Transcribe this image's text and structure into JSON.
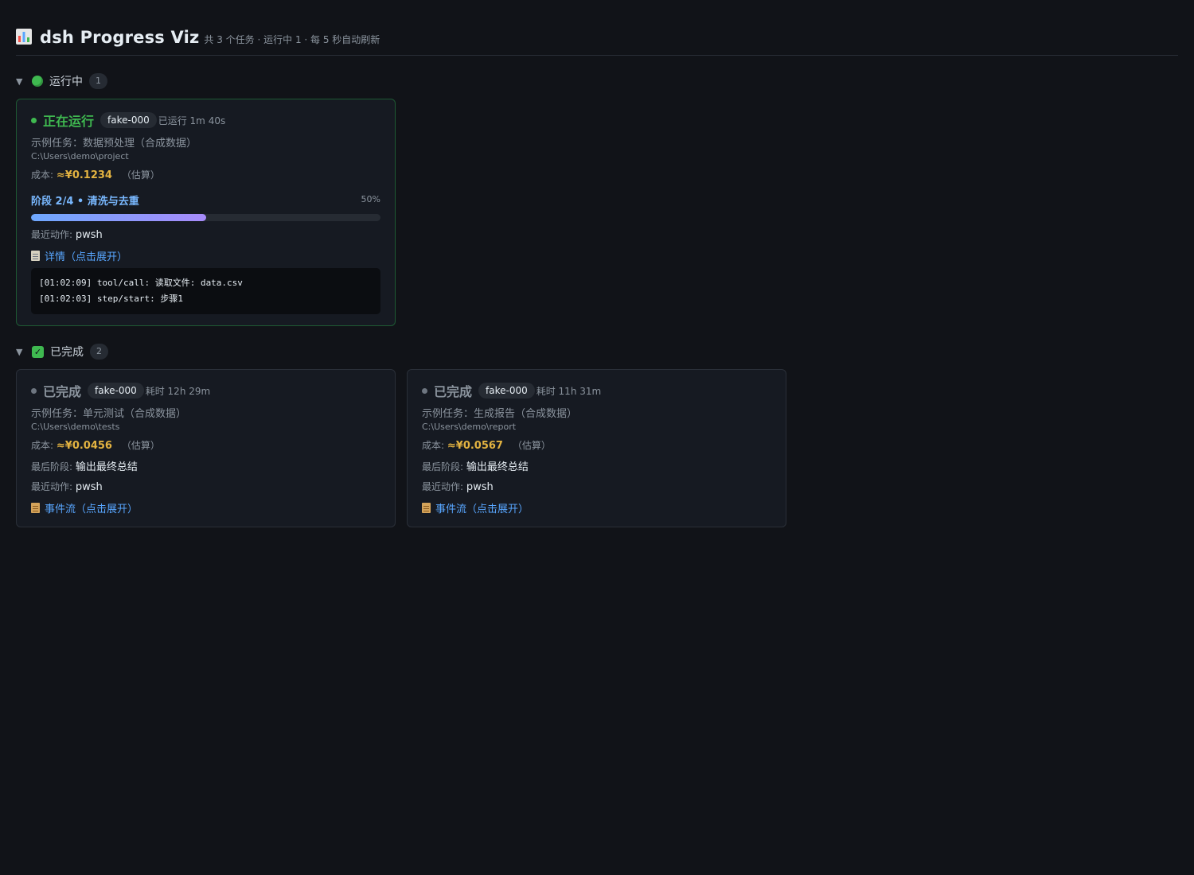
{
  "header": {
    "title": "dsh Progress Viz",
    "subtitle": "共 3 个任务 · 运行中 1 · 每 5 秒自动刷新",
    "logo_icon": "bar-chart-icon"
  },
  "sections": {
    "running": {
      "chevron": "▼",
      "label": "运行中",
      "count": "1"
    },
    "done": {
      "chevron": "▼",
      "label": "已完成",
      "count": "2",
      "check": "✓"
    }
  },
  "running_cards": [
    {
      "status": "正在运行",
      "id": "fake-000",
      "elapsed": "已运行 1m 40s",
      "desc": "示例任务：数据预处理（合成数据）",
      "path": "C:\\Users\\demo\\project",
      "cost_label": "成本:",
      "cost_value": "≈¥0.1234",
      "cost_note": "（估算）",
      "stage": "阶段 2/4 • 清洗与去重",
      "progress_text": "50%",
      "progress": 0.5,
      "action_label": "最近动作:",
      "action_value": "pwsh",
      "link": "详情（点击展开）",
      "logs": [
        "[01:02:09] tool/call: 读取文件: data.csv",
        "[01:02:03] step/start: 步骤1"
      ]
    }
  ],
  "done_cards": [
    {
      "status": "已完成",
      "id": "fake-000",
      "elapsed": "耗时 12h 29m",
      "desc": "示例任务：单元测试（合成数据）",
      "path": "C:\\Users\\demo\\tests",
      "cost_label": "成本:",
      "cost_value": "≈¥0.0456",
      "cost_note": "（估算）",
      "stage_label": "最后阶段:",
      "stage_value": "输出最终总结",
      "action_label": "最近动作:",
      "action_value": "pwsh",
      "link": "事件流（点击展开）"
    },
    {
      "status": "已完成",
      "id": "fake-000",
      "elapsed": "耗时 11h 31m",
      "desc": "示例任务：生成报告（合成数据）",
      "path": "C:\\Users\\demo\\report",
      "cost_label": "成本:",
      "cost_value": "≈¥0.0567",
      "cost_note": "（估算）",
      "stage_label": "最后阶段:",
      "stage_value": "输出最终总结",
      "action_label": "最近动作:",
      "action_value": "pwsh",
      "link": "事件流（点击展开）"
    }
  ],
  "colors": {
    "background": "#111318",
    "running": "#3fb950",
    "cost": "#e3b341",
    "link": "#58a6ff",
    "stage": "#79b8ff"
  }
}
